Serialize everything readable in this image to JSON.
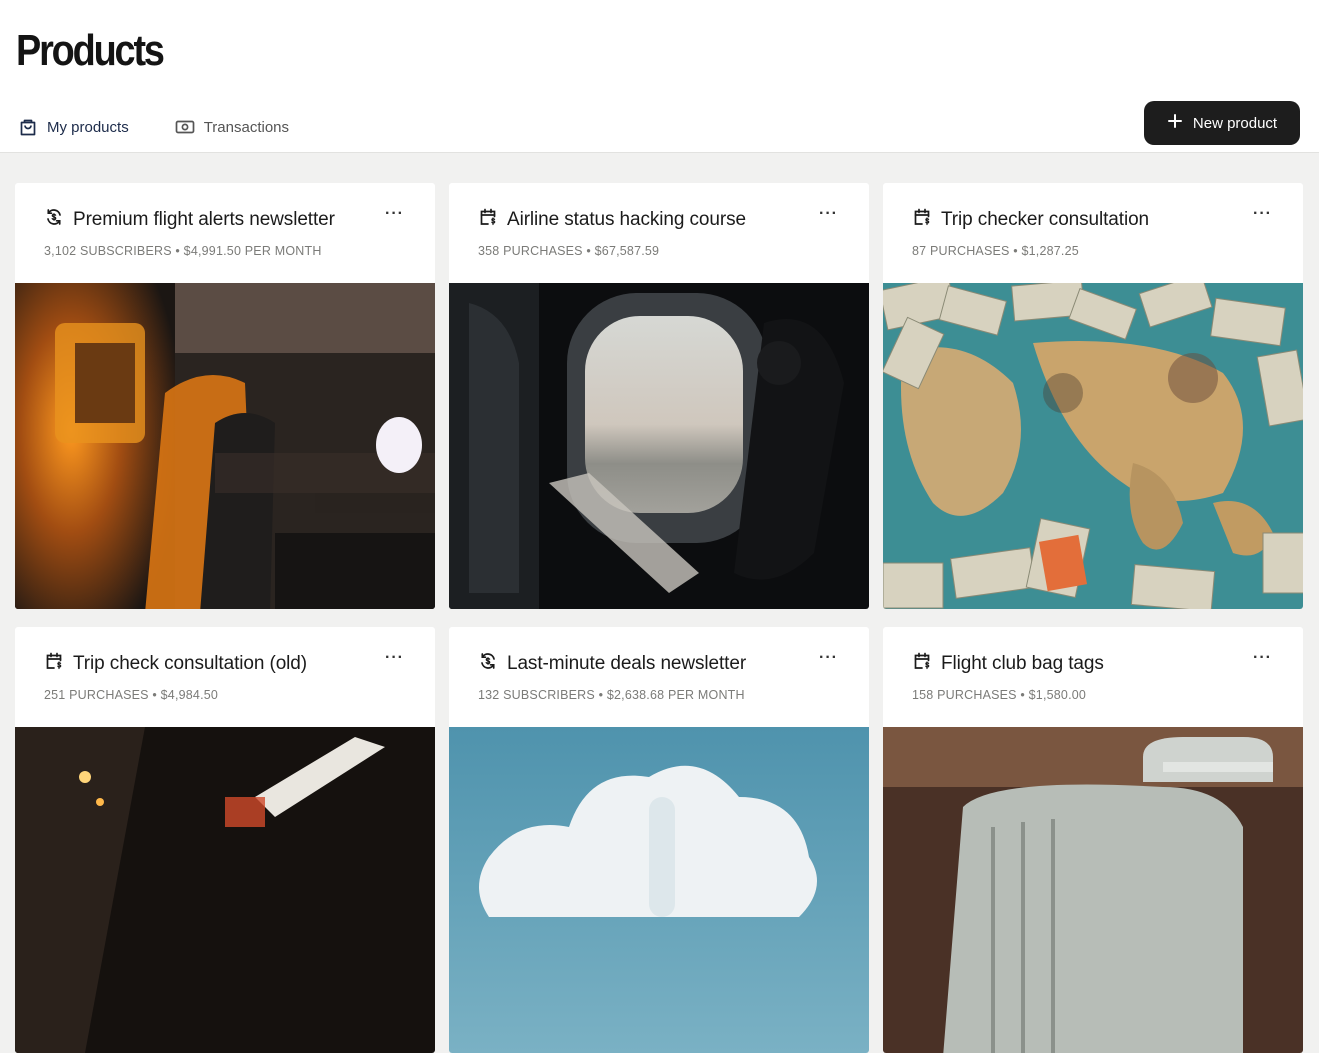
{
  "page": {
    "title": "Products"
  },
  "tabs": [
    {
      "label": "My products",
      "icon": "shopping-bag-icon",
      "active": true
    },
    {
      "label": "Transactions",
      "icon": "banknote-icon",
      "active": false
    }
  ],
  "actions": {
    "new_product_label": "New product",
    "new_product_icon": "plus-icon"
  },
  "products": [
    {
      "title": "Premium flight alerts newsletter",
      "meta": "3,102 SUBSCRIBERS • $4,991.50 PER MONTH",
      "icon": "recurring-icon",
      "image": "airplane cabin with orange-lit seats"
    },
    {
      "title": "Airline status hacking course",
      "meta": "358 PURCHASES • $67,587.59",
      "icon": "calendar-dollar-icon",
      "image": "person reading by airplane window"
    },
    {
      "title": "Trip checker consultation",
      "meta": "87 PURCHASES • $1,287.25",
      "icon": "calendar-dollar-icon",
      "image": "world map covered with banknotes"
    },
    {
      "title": "Trip check consultation (old)",
      "meta": "251 PURCHASES • $4,984.50",
      "icon": "calendar-dollar-icon",
      "image": "dark airplane cabin"
    },
    {
      "title": "Last-minute deals newsletter",
      "meta": "132 SUBSCRIBERS • $2,638.68 PER MONTH",
      "icon": "recurring-icon",
      "image": "cloud in blue sky"
    },
    {
      "title": "Flight club bag tags",
      "meta": "158 PURCHASES • $1,580.00",
      "icon": "calendar-dollar-icon",
      "image": "vintage suitcase"
    }
  ],
  "more_label": "···",
  "colors": {
    "button_bg": "#1d1d1d",
    "active_tab": "#1c2b4a",
    "background": "#f1f1f0"
  }
}
